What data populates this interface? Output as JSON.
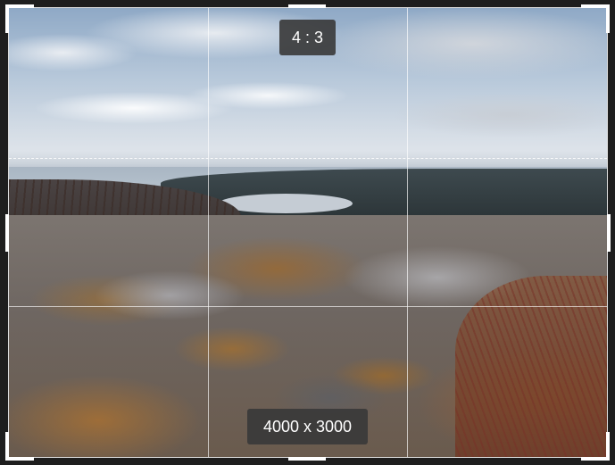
{
  "crop": {
    "aspect_ratio_label": "4 : 3",
    "dimensions_label": "4000 x 3000"
  },
  "image": {
    "description": "Rocky coastal hilltop overlooking a bay"
  },
  "colors": {
    "background": "#1e1e1e",
    "handle": "#ffffff",
    "badge_bg": "#383838"
  }
}
